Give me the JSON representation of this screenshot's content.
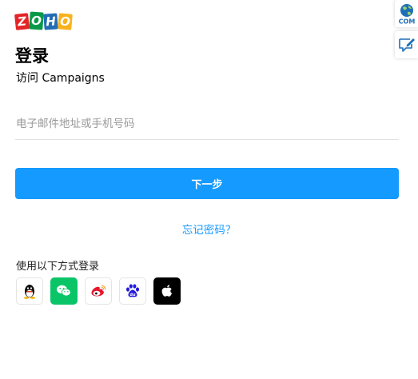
{
  "logo": {
    "letters": [
      "Z",
      "O",
      "H",
      "O"
    ]
  },
  "login": {
    "title": "登录",
    "subtitle": "访问 Campaigns",
    "email_placeholder": "电子邮件地址或手机号码",
    "email_value": "",
    "next_label": "下一步",
    "forgot_label": "忘记密码？"
  },
  "social": {
    "label": "使用以下方式登录",
    "providers": [
      {
        "name": "QQ",
        "icon": "qq-icon"
      },
      {
        "name": "WeChat",
        "icon": "wechat-icon"
      },
      {
        "name": "Weibo",
        "icon": "weibo-icon"
      },
      {
        "name": "Baidu",
        "icon": "baidu-icon"
      },
      {
        "name": "Apple",
        "icon": "apple-icon"
      }
    ]
  },
  "side": {
    "domain_label": "COM"
  },
  "colors": {
    "primary": "#159aff",
    "wechat": "#0ac567",
    "apple": "#000000"
  }
}
